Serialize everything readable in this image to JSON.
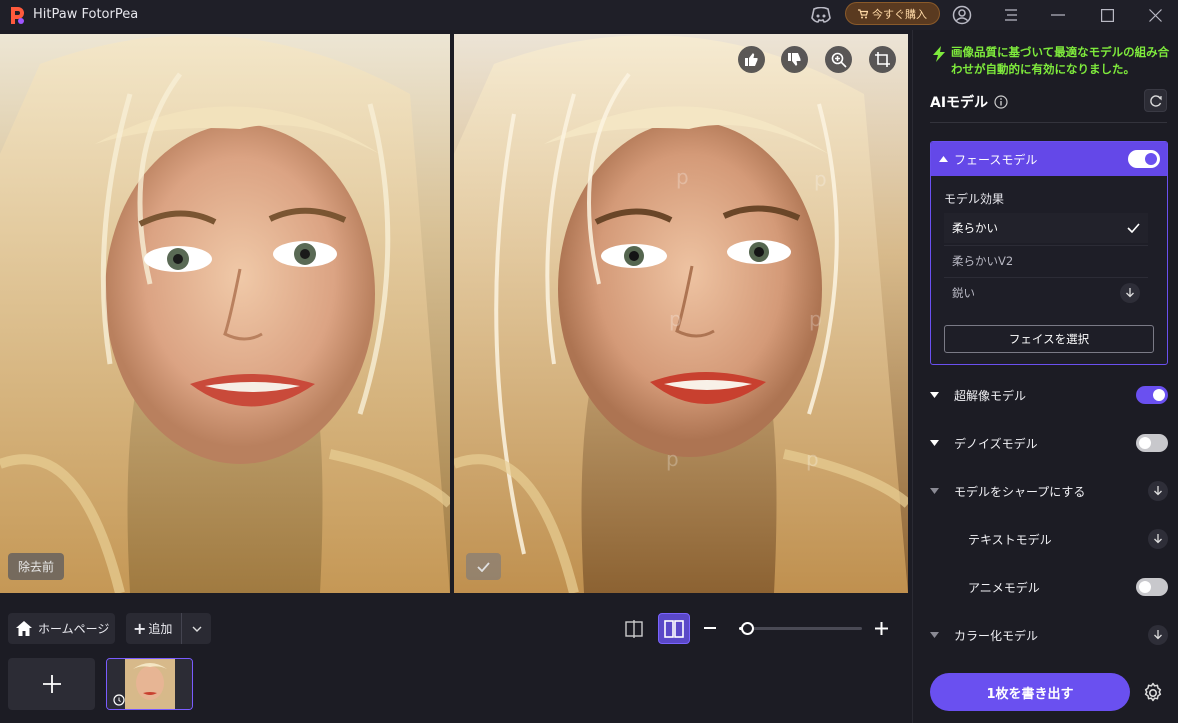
{
  "window": {
    "title": "HitPaw FotorPea",
    "buy_label": "今すぐ購入"
  },
  "preview": {
    "before_label": "除去前"
  },
  "bottom": {
    "home_label": "ホームページ",
    "add_label": "追加",
    "zoom_level": 0.03
  },
  "panel": {
    "notice": "画像品質に基づいて最適なモデルの組み合わせが自動的に有効になりました。",
    "ai_title": "AIモデル",
    "face": {
      "label": "フェースモデル",
      "enabled": true,
      "effect_label": "モデル効果",
      "options": [
        {
          "label": "柔らかい",
          "selected": true
        },
        {
          "label": "柔らかいV2",
          "selected": false
        },
        {
          "label": "鋭い",
          "selected": false
        }
      ],
      "select_button": "フェイスを選択"
    },
    "models": [
      {
        "label": "超解像モデル",
        "state": "on"
      },
      {
        "label": "デノイズモデル",
        "state": "off"
      },
      {
        "label": "モデルをシャープにする",
        "state": "download"
      },
      {
        "label": "テキストモデル",
        "state": "download"
      },
      {
        "label": "アニメモデル",
        "state": "off"
      },
      {
        "label": "カラー化モデル",
        "state": "download"
      }
    ],
    "export_label": "1枚を書き出す"
  },
  "colors": {
    "accent": "#6a50f0",
    "notice": "#7eea3c",
    "background": "#1c1c24"
  }
}
